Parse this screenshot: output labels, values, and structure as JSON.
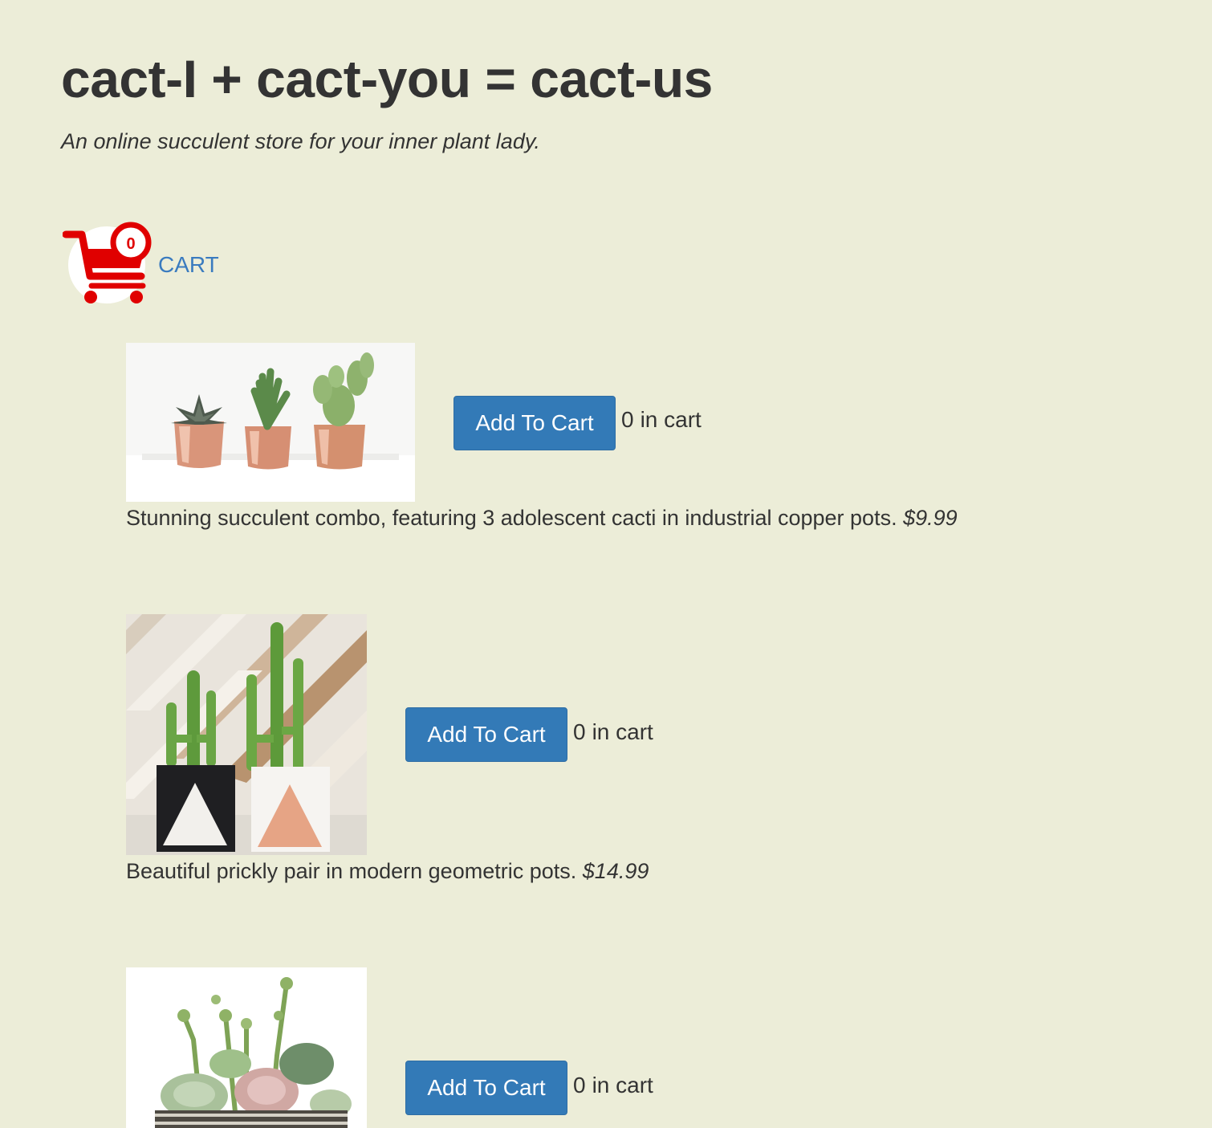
{
  "header": {
    "title": "cact-I + cact-you = cact-us",
    "tagline": "An online succulent store for your inner plant lady."
  },
  "cart": {
    "label": "CART",
    "count": "0",
    "icon": "shopping-cart-icon",
    "icon_color": "#e00000"
  },
  "products": [
    {
      "description": "Stunning succulent combo, featuring 3 adolescent cacti in industrial copper pots.",
      "price": "$9.99",
      "button_label": "Add To Cart",
      "in_cart_count": "0",
      "in_cart_label": "in cart"
    },
    {
      "description": "Beautiful prickly pair in modern geometric pots.",
      "price": "$14.99",
      "button_label": "Add To Cart",
      "in_cart_count": "0",
      "in_cart_label": "in cart"
    },
    {
      "description": "",
      "price": "",
      "button_label": "Add To Cart",
      "in_cart_count": "0",
      "in_cart_label": "in cart"
    }
  ],
  "colors": {
    "background": "#ecedd8",
    "button": "#337ab7",
    "link": "#3a7bbf",
    "text": "#333333"
  }
}
